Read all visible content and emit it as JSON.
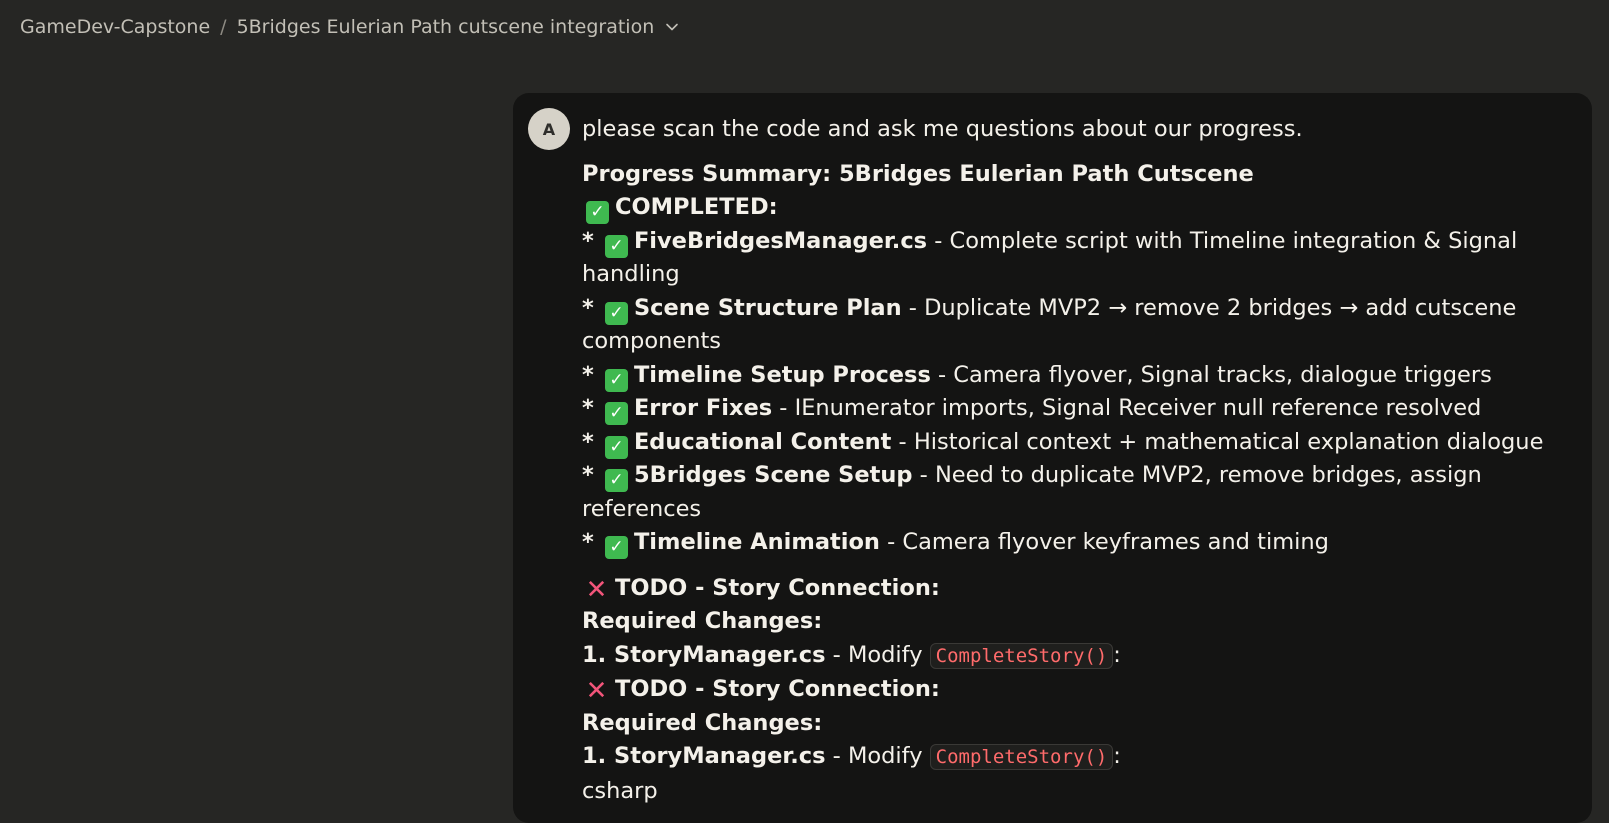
{
  "breadcrumb": {
    "project": "GameDev-Capstone",
    "separator": "/",
    "chat_title": "5Bridges Eulerian Path cutscene integration",
    "dropdown_icon": "chevron-down-icon"
  },
  "message": {
    "avatar_initial": "A",
    "prompt": "please scan the code and ask me questions about our progress.",
    "summary_title": "Progress Summary: 5Bridges Eulerian Path Cutscene",
    "completed_heading": "COMPLETED:",
    "bullet": "*",
    "completed_items": [
      {
        "name": "FiveBridgesManager.cs",
        "desc": " - Complete script with Timeline integration & Signal handling"
      },
      {
        "name": "Scene Structure Plan",
        "desc": " - Duplicate MVP2 → remove 2 bridges → add cutscene components"
      },
      {
        "name": "Timeline Setup Process",
        "desc": " - Camera flyover, Signal tracks, dialogue triggers"
      },
      {
        "name": "Error Fixes",
        "desc": " - IEnumerator imports, Signal Receiver null reference resolved"
      },
      {
        "name": "Educational Content",
        "desc": " - Historical context + mathematical explanation dialogue"
      },
      {
        "name": "5Bridges Scene Setup",
        "desc": " - Need to duplicate MVP2, remove bridges, assign references"
      },
      {
        "name": "Timeline Animation",
        "desc": " - Camera flyover keyframes and timing"
      }
    ],
    "todo_heading": "TODO - Story Connection:",
    "required_changes": "Required Changes:",
    "step1_label": "1. StoryManager.cs",
    "step1_modify": " - Modify ",
    "step1_code": "CompleteStory()",
    "colon": ":",
    "trailing_text": "csharp"
  },
  "colors": {
    "background": "#262624",
    "message_bg": "#141413",
    "check_green": "#3fb950",
    "cross_red": "#f2557a",
    "code_red": "#ff6b6b"
  }
}
